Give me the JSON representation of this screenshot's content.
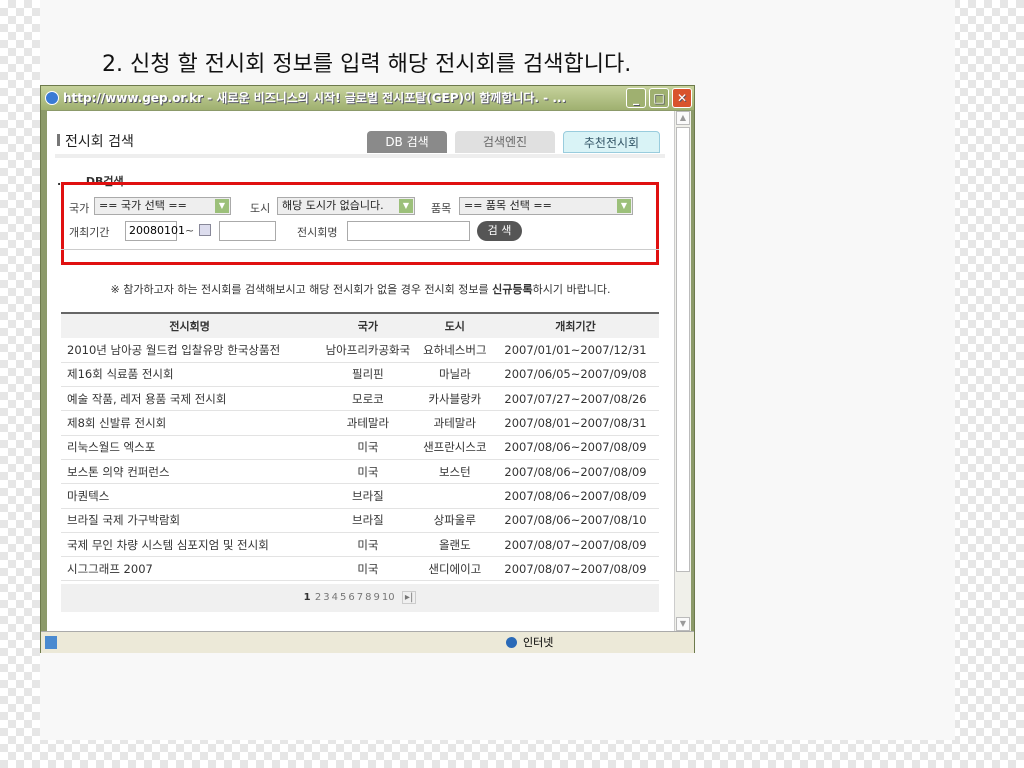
{
  "slide_title": "2. 신청 할 전시회 정보를 입력 해당 전시회를 검색합니다.",
  "window": {
    "title": "http://www.gep.or.kr - 새로운 비즈니스의 시작! 글로벌 전시포탈(GEP)이 함께합니다. - ...",
    "status_zone": "인터넷"
  },
  "page": {
    "heading": "전시회 검색",
    "tabs": [
      "DB 검색",
      "검색엔진",
      "추천전시회"
    ],
    "section": "...... DB검색 ......"
  },
  "form": {
    "country_label": "국가",
    "country_value": "== 국가 선택 ==",
    "city_label": "도시",
    "city_value": "해당 도시가 없습니다.",
    "item_label": "품목",
    "item_value": "== 품목 선택 ==",
    "period_label": "개최기간",
    "period_start": "20080101",
    "tilde": "~",
    "period_end": "",
    "name_label": "전시회명",
    "name_value": "",
    "search_button": "검 색"
  },
  "notice": {
    "pre": "※ 참가하고자 하는 전시회를 검색해보시고 해당 전시회가 없을 경우 전시회 정보를 ",
    "link": "신규등록",
    "post": "하시기 바랍니다."
  },
  "table": {
    "headers": [
      "전시회명",
      "국가",
      "도시",
      "개최기간"
    ],
    "rows": [
      [
        "2010년 남아공 월드컵 입찰유망 한국상품전",
        "남아프리카공화국",
        "요하네스버그",
        "2007/01/01~2007/12/31"
      ],
      [
        "제16회 식료품 전시회",
        "필리핀",
        "마닐라",
        "2007/06/05~2007/09/08"
      ],
      [
        "예술 작품, 레저 용품 국제 전시회",
        "모로코",
        "카사블랑카",
        "2007/07/27~2007/08/26"
      ],
      [
        "제8회 신발류 전시회",
        "과테말라",
        "과테말라",
        "2007/08/01~2007/08/31"
      ],
      [
        "리눅스월드 엑스포",
        "미국",
        "샌프란시스코",
        "2007/08/06~2007/08/09"
      ],
      [
        "보스톤 의약 컨퍼런스",
        "미국",
        "보스턴",
        "2007/08/06~2007/08/09"
      ],
      [
        "마퀀텍스",
        "브라질",
        "",
        "2007/08/06~2007/08/09"
      ],
      [
        "브라질 국제 가구박람회",
        "브라질",
        "상파울루",
        "2007/08/06~2007/08/10"
      ],
      [
        "국제 무인 차량 시스템 심포지엄 및 전시회",
        "미국",
        "올랜도",
        "2007/08/07~2007/08/09"
      ],
      [
        "시그그래프 2007",
        "미국",
        "샌디에이고",
        "2007/08/07~2007/08/09"
      ]
    ]
  },
  "pagination": {
    "current": "1",
    "pages": [
      "2",
      "3",
      "4",
      "5",
      "6",
      "7",
      "8",
      "9",
      "10"
    ],
    "next": "▸|"
  }
}
